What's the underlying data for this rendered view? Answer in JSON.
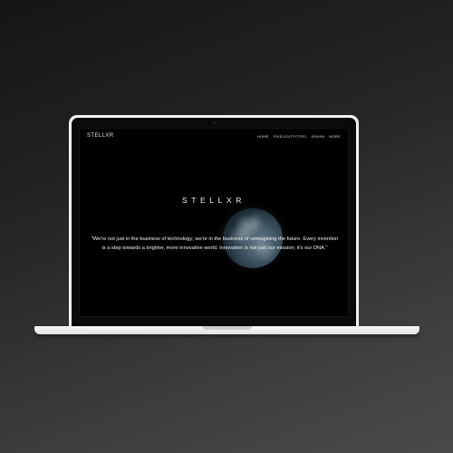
{
  "site": {
    "brand": "STELLXR",
    "nav": [
      "HOME",
      "PIXELOUTFITTED",
      "ASHAN",
      "MORE"
    ],
    "logo": "STELLXR",
    "quote": "\"We're not just in the business of technology; we're in the business of reimagining the future. Every invention is a step towards a brighter, more innovative world. Innovation is not just our mission; it's our DNA.\""
  },
  "icons": {
    "planet": "planet-earth-image"
  }
}
